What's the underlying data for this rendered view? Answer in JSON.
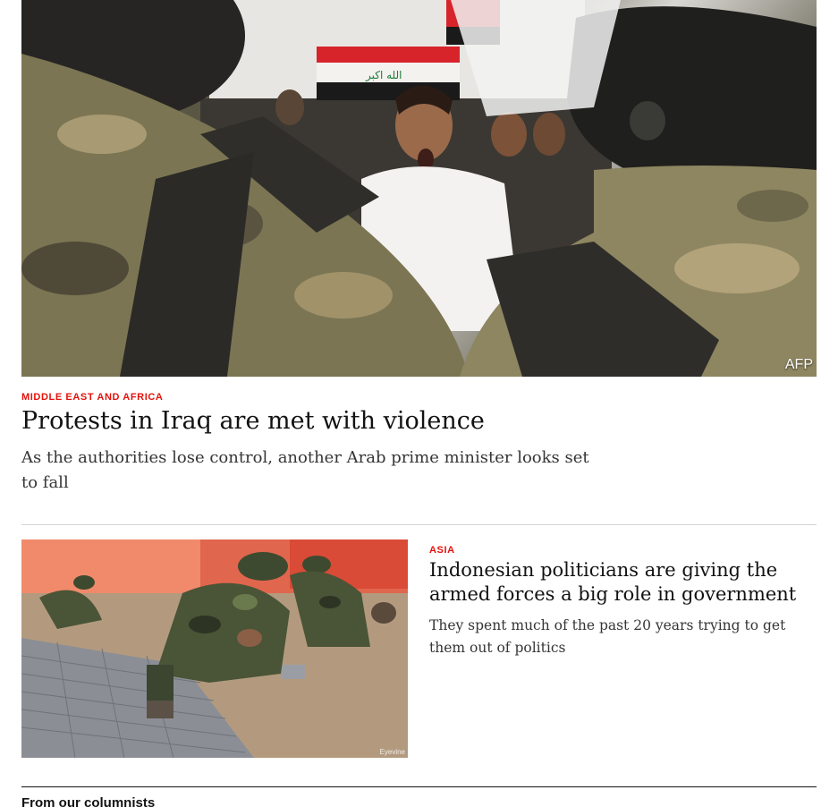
{
  "lead_story": {
    "image_alt": "Protester shouting in front of riot police holding an Iraqi flag",
    "photo_credit": "AFP",
    "section": "Middle East and Africa",
    "headline": "Protests in Iraq are met with violence",
    "description": "As the authorities lose control, another Arab prime minister looks set to fall"
  },
  "second_story": {
    "image_alt": "Soldiers laying paving bricks",
    "photo_credit": "Eyevine",
    "section": "Asia",
    "headline": "Indonesian politicians are giving the armed forces a big role in government",
    "description": "They spent much of the past 20 years trying to get them out of politics"
  },
  "columnists": {
    "heading": "From our columnists"
  },
  "colors": {
    "section_label": "#e3120b",
    "text": "#121212",
    "secondary_text": "#353535",
    "divider": "#d3d3d3"
  }
}
